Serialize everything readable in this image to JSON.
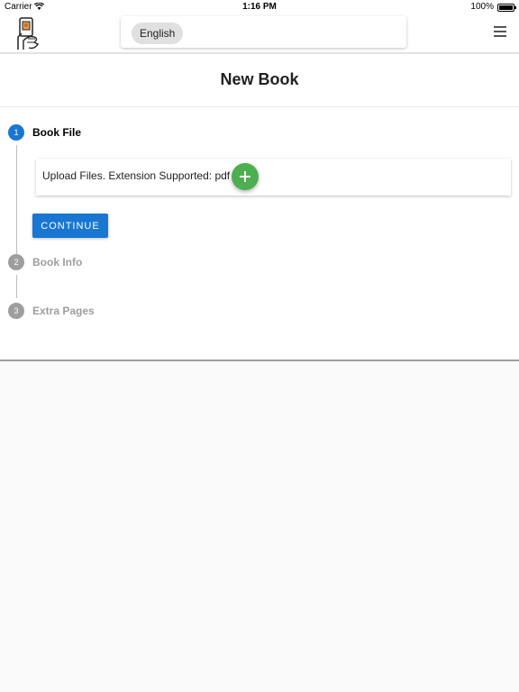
{
  "status_bar": {
    "carrier": "Carrier",
    "time": "1:16 PM",
    "battery": "100%"
  },
  "header": {
    "language_chip": "English",
    "icons": {
      "logo": "book-hand-logo",
      "menu": "hamburger-menu-icon"
    }
  },
  "page": {
    "title": "New Book"
  },
  "stepper": {
    "steps": [
      {
        "number": "1",
        "label": "Book File",
        "active": true
      },
      {
        "number": "2",
        "label": "Book Info",
        "active": false
      },
      {
        "number": "3",
        "label": "Extra Pages",
        "active": false
      }
    ],
    "upload_text": "Upload Files. Extension Supported: pdf",
    "continue_label": "CONTINUE"
  },
  "colors": {
    "primary": "#1976d2",
    "fab": "#4caf50",
    "inactive": "#9e9e9e",
    "background": "#fafafa"
  }
}
